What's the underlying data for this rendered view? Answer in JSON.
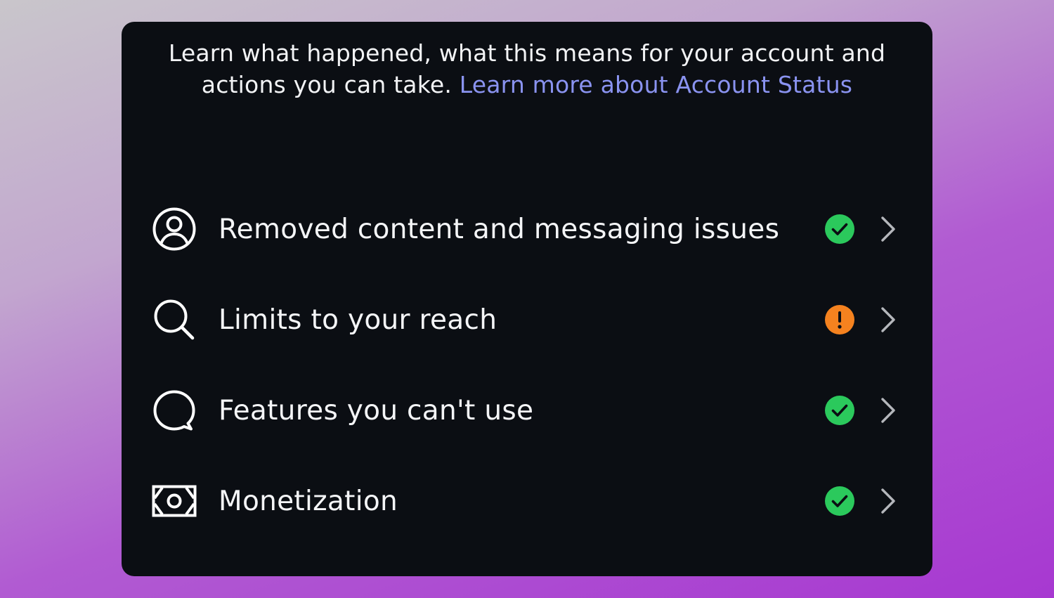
{
  "intro": {
    "text": "Learn what happened, what this means for your account and actions you can take. ",
    "link": "Learn more about Account Status"
  },
  "rows": [
    {
      "label": "Removed content and messaging issues",
      "icon": "person-circle-icon",
      "status": "ok",
      "status_color": "#2bc95c"
    },
    {
      "label": "Limits to your reach",
      "icon": "search-icon",
      "status": "warning",
      "status_color": "#f5821f"
    },
    {
      "label": "Features you can't use",
      "icon": "speech-bubble-icon",
      "status": "ok",
      "status_color": "#2bc95c"
    },
    {
      "label": "Monetization",
      "icon": "money-icon",
      "status": "ok",
      "status_color": "#2bc95c"
    }
  ],
  "colors": {
    "card_bg": "#0b0e13",
    "link": "#8a93f0",
    "ok": "#2bc95c",
    "warning": "#f5821f"
  }
}
